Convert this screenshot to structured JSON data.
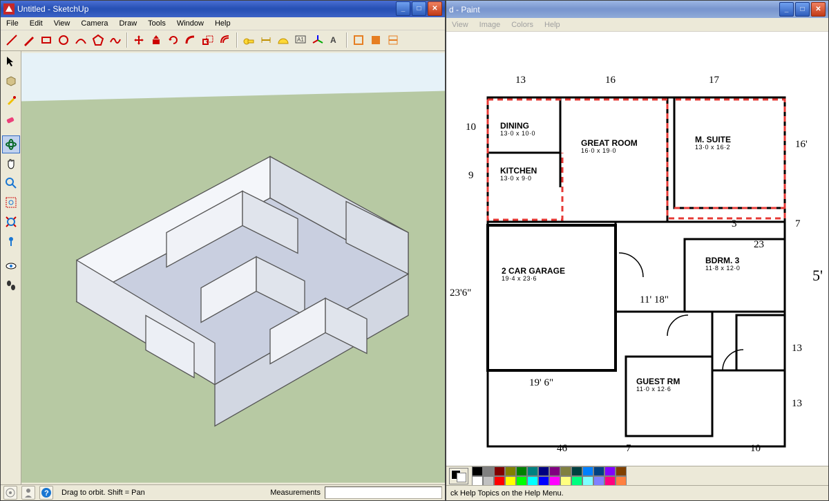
{
  "sketchup": {
    "title": "Untitled - SketchUp",
    "menus": [
      "File",
      "Edit",
      "View",
      "Camera",
      "Draw",
      "Tools",
      "Window",
      "Help"
    ],
    "status_hint": "Drag to orbit.  Shift = Pan",
    "measurements_label": "Measurements"
  },
  "paint": {
    "title": "d - Paint",
    "menus": [
      "View",
      "Image",
      "Colors",
      "Help"
    ],
    "status": "ck Help Topics on the Help Menu.",
    "palette": [
      "#000000",
      "#808080",
      "#800000",
      "#808000",
      "#008000",
      "#008080",
      "#000080",
      "#800080",
      "#808040",
      "#004040",
      "#0080ff",
      "#004080",
      "#8000ff",
      "#804000",
      "#ffffff",
      "#c0c0c0",
      "#ff0000",
      "#ffff00",
      "#00ff00",
      "#00ffff",
      "#0000ff",
      "#ff00ff",
      "#ffff80",
      "#00ff80",
      "#80ffff",
      "#8080ff",
      "#ff0080",
      "#ff8040"
    ]
  },
  "floorplan": {
    "rooms": {
      "dining": {
        "label": "DINING",
        "dim": "13·0 x 10·0"
      },
      "kitchen": {
        "label": "KITCHEN",
        "dim": "13·0 x 9·0"
      },
      "great_room": {
        "label": "GREAT ROOM",
        "dim": "16·0 x 19·0"
      },
      "m_suite": {
        "label": "M. SUITE",
        "dim": "13·0 x 16·2"
      },
      "garage": {
        "label": "2 CAR GARAGE",
        "dim": "19·4 x 23·6"
      },
      "bdrm3": {
        "label": "BDRM. 3",
        "dim": "11·8 x 12·0"
      },
      "guest_rm": {
        "label": "GUEST RM",
        "dim": "11·0 x 12·6"
      }
    },
    "annotations": {
      "a1": "13",
      "a2": "16",
      "a3": "17",
      "a4": "10",
      "a5": "16'",
      "a6": "9",
      "a7": "7",
      "a8": "23'6\"",
      "a9": "23",
      "a10": "11' 18\"",
      "a11": "19' 6\"",
      "a12": "13",
      "a13": "5'",
      "a14": "46",
      "a15": "7",
      "a16": "10",
      "a17": "13",
      "a18": "3"
    }
  }
}
